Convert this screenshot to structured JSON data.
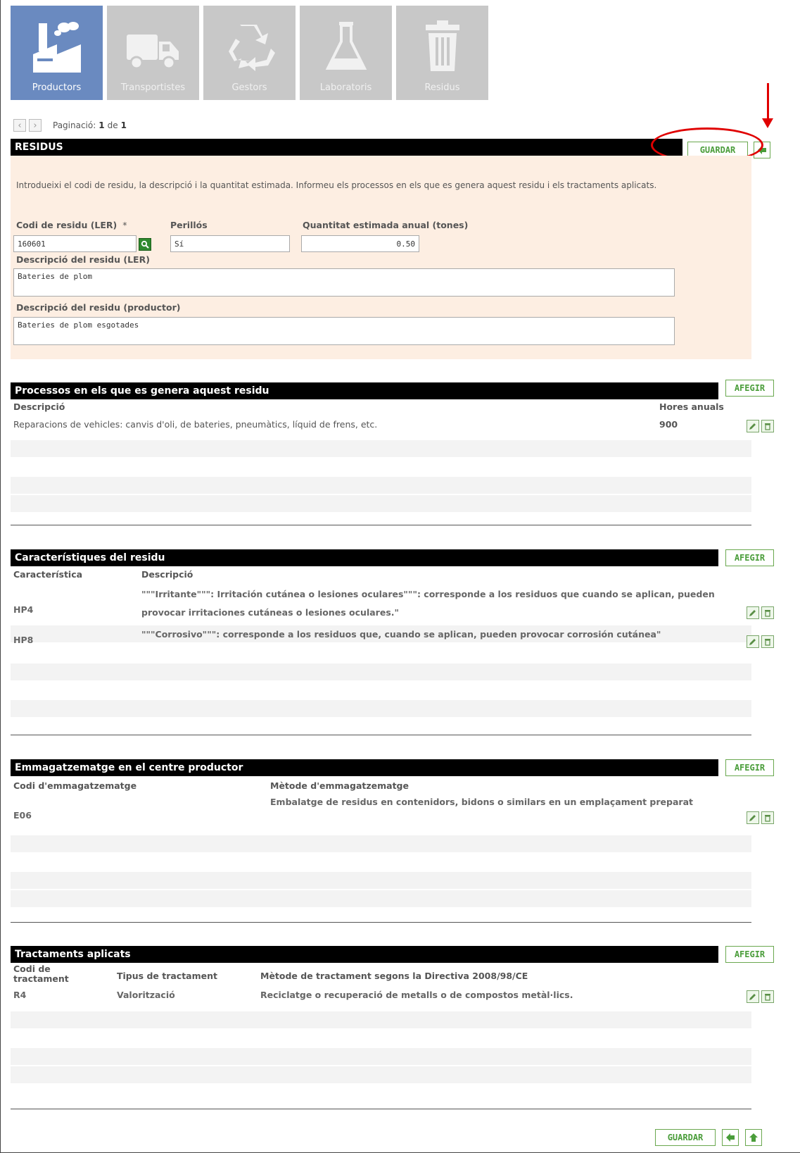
{
  "nav": {
    "tabs": [
      {
        "label": "Productors",
        "icon": "factory-icon",
        "active": true
      },
      {
        "label": "Transportistes",
        "icon": "truck-icon",
        "active": false
      },
      {
        "label": "Gestors",
        "icon": "recycle-icon",
        "active": false
      },
      {
        "label": "Laboratoris",
        "icon": "flask-icon",
        "active": false
      },
      {
        "label": "Residus",
        "icon": "trash-icon",
        "active": false
      }
    ]
  },
  "pager": {
    "label": "Paginació:",
    "current": "1",
    "of": "de",
    "total": "1"
  },
  "residus": {
    "title": "RESIDUS",
    "save": "GUARDAR",
    "intro": "Introdueixi el codi de residu, la descripció i la quantitat estimada. Informeu els processos en els que es genera aquest residu i els tractaments aplicats.",
    "codi_label": "Codi de residu (LER)",
    "required": "*",
    "codi_value": "160601",
    "perillos_label": "Perillós",
    "perillos_value": "Sí",
    "quantitat_label": "Quantitat estimada anual (tones)",
    "quantitat_value": "0.50",
    "desc_ler_label": "Descripció del residu (LER)",
    "desc_ler_value": "Bateries de plom",
    "desc_prod_label": "Descripció del residu (productor)",
    "desc_prod_value": "Bateries de plom esgotades"
  },
  "processos": {
    "title": "Processos en els que es genera aquest residu",
    "add": "AFEGIR",
    "col_desc": "Descripció",
    "col_hores": "Hores anuals",
    "rows": [
      {
        "desc": "Reparacions de vehicles: canvis d'oli, de bateries, pneumàtics, líquid de frens, etc.",
        "hores": "900"
      }
    ]
  },
  "caracteristiques": {
    "title": "Característiques del residu",
    "add": "AFEGIR",
    "col_code": "Característica",
    "col_desc": "Descripció",
    "rows": [
      {
        "code": "HP4",
        "desc": "\"\"\"Irritante\"\"\": Irritación cutánea o lesiones oculares\"\"\": corresponde a los residuos que cuando se aplican, pueden provocar irritaciones cutáneas o lesiones oculares.\""
      },
      {
        "code": "HP8",
        "desc": "\"\"\"Corrosivo\"\"\": corresponde a los residuos que, cuando se aplican, pueden provocar corrosión cutánea\""
      }
    ]
  },
  "emmagatzematge": {
    "title": "Emmagatzematge en el centre productor",
    "add": "AFEGIR",
    "col_code": "Codi d'emmagatzematge",
    "col_method": "Mètode d'emmagatzematge",
    "rows": [
      {
        "code": "E06",
        "method": "Embalatge de residus en contenidors, bidons o similars en un emplaçament preparat"
      }
    ]
  },
  "tractaments": {
    "title": "Tractaments aplicats",
    "add": "AFEGIR",
    "col_code": "Codi de tractament",
    "col_tipus": "Tipus de tractament",
    "col_metode": "Mètode de tractament segons la Directiva 2008/98/CE",
    "rows": [
      {
        "code": "R4",
        "tipus": "Valorització",
        "metode": "Reciclatge o recuperació de metalls o de compostos metàl·lics."
      }
    ]
  },
  "footer": {
    "save": "GUARDAR"
  },
  "colors": {
    "active_tab": "#6a8ac0",
    "inactive_tab": "#c8c8c8",
    "accent_green": "#4a9d3a",
    "form_bg": "#fdeee2",
    "annotation": "#e00000"
  }
}
